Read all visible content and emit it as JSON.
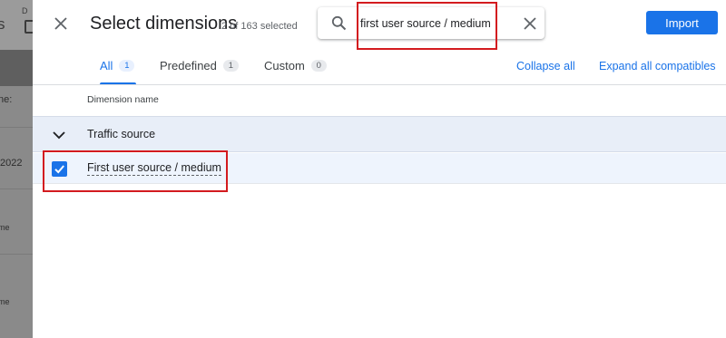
{
  "background": {
    "partial_texts": [
      "s",
      "D",
      "ne:",
      "2022",
      "me",
      "me"
    ]
  },
  "dialog": {
    "title": "Select dimensions",
    "selected_count": "2 of 163 selected",
    "search": {
      "value": "first user source / medium",
      "placeholder": ""
    },
    "import_label": "Import",
    "tabs": [
      {
        "label": "All",
        "count": "1",
        "active": true
      },
      {
        "label": "Predefined",
        "count": "1",
        "active": false
      },
      {
        "label": "Custom",
        "count": "0",
        "active": false
      }
    ],
    "collapse_all_label": "Collapse all",
    "expand_all_label": "Expand all compatibles",
    "column_header": "Dimension name",
    "groups": [
      {
        "label": "Traffic source",
        "expanded": true,
        "items": [
          {
            "label": "First user source / medium",
            "checked": true
          }
        ]
      }
    ]
  },
  "icons": {
    "close": "close-icon",
    "search": "search-icon",
    "clear": "clear-search-icon",
    "expand": "chevron-down-icon",
    "check": "check-icon"
  },
  "colors": {
    "accent": "#1a73e8",
    "highlight": "#d31b1f",
    "group_row_bg": "#e8eef8",
    "selected_row_bg": "#eef4fd"
  }
}
